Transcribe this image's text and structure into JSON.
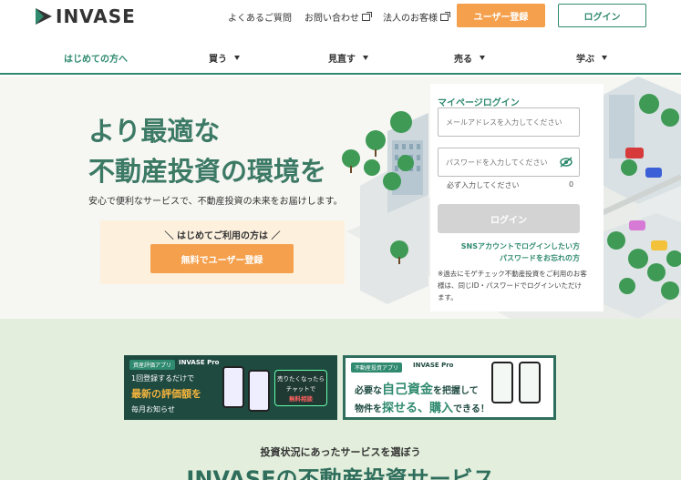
{
  "brand": {
    "logo_text": "INVASE"
  },
  "header": {
    "links": [
      {
        "label": "よくあるご質問",
        "external": false
      },
      {
        "label": "お問い合わせ",
        "external": true
      },
      {
        "label": "法人のお客様",
        "external": true
      }
    ],
    "register_label": "ユーザー登録",
    "login_label": "ログイン"
  },
  "nav": {
    "items": [
      {
        "label": "はじめての方へ",
        "active": true
      },
      {
        "label": "買う"
      },
      {
        "label": "見直す"
      },
      {
        "label": "売る"
      },
      {
        "label": "学ぶ"
      }
    ]
  },
  "hero": {
    "title_line1": "より最適な",
    "title_line2": "不動産投資の環境を",
    "subtitle": "安心で便利なサービスで、不動産投資の未来をお届けします。",
    "cta_caption": "＼ はじめてご利用の方は ／",
    "cta_button": "無料でユーザー登録"
  },
  "login": {
    "title": "マイページログイン",
    "email_placeholder": "メールアドレスを入力してください",
    "password_placeholder": "パスワードを入力してください",
    "required_note": "必ず入力してください",
    "required_count": "0",
    "button": "ログイン",
    "sns_link": "SNSアカウントでログインしたい方",
    "forgot_link": "パスワードをお忘れの方",
    "note": "※過去にモゲチェック不動産投資をご利用のお客様は、同じID・パスワードでログインいただけます。"
  },
  "banners": [
    {
      "tag": "資産評価アプリ",
      "brand": "INVASE Pro",
      "line1": "1回登録するだけで",
      "line2": "最新の評価額を",
      "line3": "毎月お知らせ",
      "bubble_line1": "売りたくなったら",
      "bubble_line2": "チャットで",
      "bubble_line3": "無料相談"
    },
    {
      "tag": "不動産投資アプリ",
      "brand": "INVASE Pro",
      "line1_pre": "必要な",
      "line1_hl": "自己資金",
      "line1_post": "を把握して",
      "line2_pre": "物件を",
      "line2_hl": "探せる、購入",
      "line2_post": "できる！"
    }
  ],
  "services": {
    "caption": "投資状況にあったサービスを選ぼう",
    "title": "INVASEの不動産投資サービス"
  },
  "colors": {
    "accent": "#2f8a6f",
    "cta": "#f5a04d",
    "hero_title": "#3c7a66",
    "lower_bg": "#e3efdc"
  }
}
